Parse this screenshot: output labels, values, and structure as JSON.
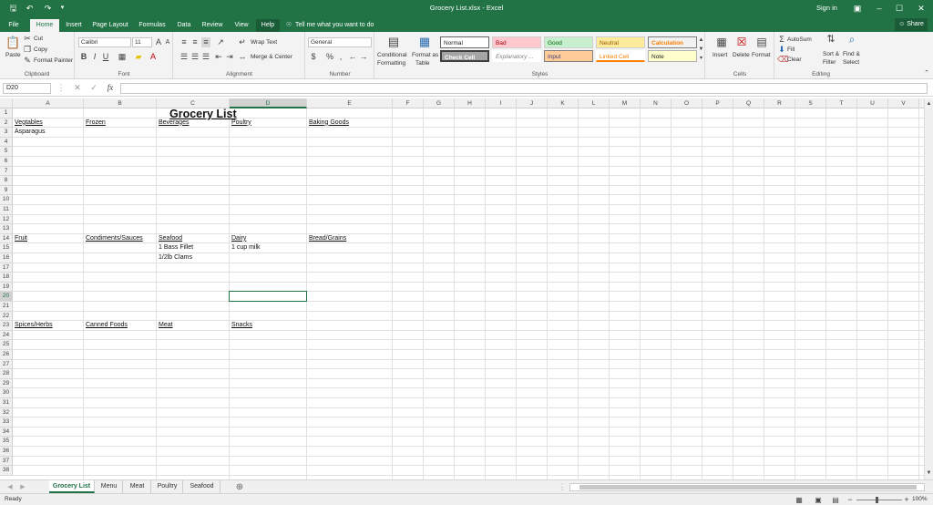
{
  "app": {
    "title": "Grocery List.xlsx  -  Excel",
    "signin": "Sign in",
    "share": "Share"
  },
  "quick_access": {
    "save_icon": "save-icon",
    "undo_icon": "undo-icon",
    "redo_icon": "redo-icon"
  },
  "tabs": [
    {
      "label": "File"
    },
    {
      "label": "Home"
    },
    {
      "label": "Insert"
    },
    {
      "label": "Page Layout"
    },
    {
      "label": "Formulas"
    },
    {
      "label": "Data"
    },
    {
      "label": "Review"
    },
    {
      "label": "View"
    },
    {
      "label": "Help"
    }
  ],
  "tell_me": "Tell me what you want to do",
  "ribbon": {
    "clipboard": {
      "paste": "Paste",
      "cut": "Cut",
      "copy": "Copy",
      "format_painter": "Format Painter",
      "label": "Clipboard"
    },
    "font": {
      "name": "Calibri",
      "size": "11",
      "bold": "B",
      "italic": "I",
      "underline": "U",
      "label": "Font"
    },
    "alignment": {
      "wrap": "Wrap Text",
      "merge": "Merge & Center",
      "label": "Alignment"
    },
    "number": {
      "format": "General",
      "currency": "$",
      "percent": "%",
      "comma": ",",
      "label": "Number"
    },
    "styles": {
      "conditional": "Conditional",
      "conditional2": "Formatting",
      "format_table": "Format as",
      "format_table2": "Table",
      "label": "Styles",
      "cells": [
        {
          "label": "Normal"
        },
        {
          "label": "Bad"
        },
        {
          "label": "Good"
        },
        {
          "label": "Neutral"
        },
        {
          "label": "Calculation"
        },
        {
          "label": "Check Cell"
        },
        {
          "label": "Explanatory ..."
        },
        {
          "label": "Input"
        },
        {
          "label": "Linked Cell"
        },
        {
          "label": "Note"
        }
      ]
    },
    "cells": {
      "insert": "Insert",
      "delete": "Delete",
      "format": "Format",
      "label": "Cells"
    },
    "editing": {
      "autosum": "AutoSum",
      "fill": "Fill",
      "clear": "Clear",
      "sort": "Sort &",
      "sort2": "Filter",
      "find": "Find &",
      "find2": "Select",
      "label": "Editing"
    }
  },
  "namebox": "D20",
  "columns": [
    "A",
    "B",
    "C",
    "D",
    "E",
    "F",
    "G",
    "H",
    "I",
    "J",
    "K",
    "L",
    "M",
    "N",
    "O",
    "P",
    "Q",
    "R",
    "S",
    "T",
    "U",
    "V"
  ],
  "rows": [
    "1",
    "2",
    "3",
    "4",
    "5",
    "6",
    "7",
    "8",
    "9",
    "10",
    "11",
    "12",
    "13",
    "14",
    "15",
    "16",
    "17",
    "18",
    "19",
    "20",
    "21",
    "22",
    "23",
    "24",
    "25",
    "26",
    "27",
    "28",
    "29",
    "30",
    "31",
    "32",
    "33",
    "34",
    "35",
    "36",
    "37",
    "38"
  ],
  "sheet": {
    "title": "Grocery List",
    "row2": [
      "Vegtables",
      "Frozen",
      "Beverages",
      "Poultry",
      "Baking Goods"
    ],
    "row3": [
      "Asparagus"
    ],
    "row14": [
      "Fruit",
      "Condiments/Sauces",
      "Seafood",
      "Dairy",
      "Bread/Grains"
    ],
    "row15": [
      "1 Bass Fillet",
      "1 cup milk"
    ],
    "row16": [
      "1/2lb Clams"
    ],
    "row23": [
      "Spices/Herbs",
      "Canned Foods",
      "Meat",
      "Snacks"
    ]
  },
  "sheet_tabs": [
    {
      "label": "Grocery List"
    },
    {
      "label": "Menu"
    },
    {
      "label": "Meat"
    },
    {
      "label": "Poultry"
    },
    {
      "label": "Seafood"
    }
  ],
  "status": {
    "ready": "Ready",
    "zoom": "100%"
  }
}
